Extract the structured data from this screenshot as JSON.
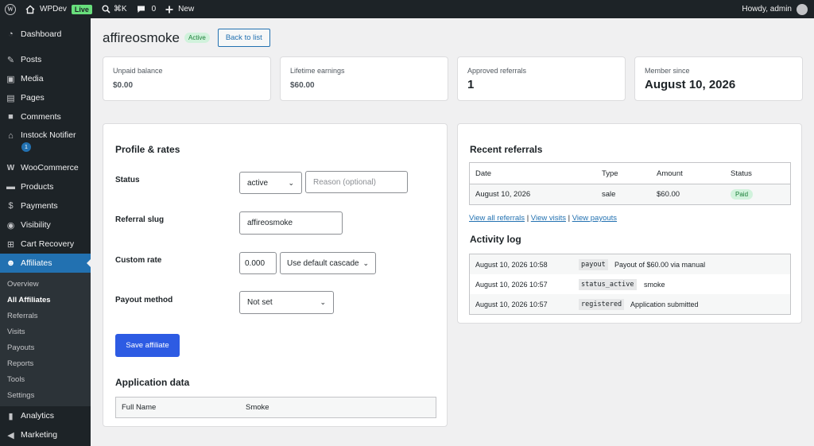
{
  "adminbar": {
    "site_name": "WPDev",
    "live_label": "Live",
    "search_shortcut": "⌘K",
    "comments_count": "0",
    "new_label": "New",
    "greeting": "Howdy, admin"
  },
  "sidebar": {
    "items": [
      {
        "label": "Dashboard",
        "icon": "dashboard-icon"
      },
      {
        "label": "Posts",
        "icon": "pin-icon"
      },
      {
        "label": "Media",
        "icon": "media-icon"
      },
      {
        "label": "Pages",
        "icon": "pages-icon"
      },
      {
        "label": "Comments",
        "icon": "comment-icon"
      },
      {
        "label": "Instock Notifier",
        "icon": "store-icon",
        "badge": "1"
      },
      {
        "label": "WooCommerce",
        "icon": "woo-icon"
      },
      {
        "label": "Products",
        "icon": "archive-icon"
      },
      {
        "label": "Payments",
        "icon": "dollar-icon"
      },
      {
        "label": "Visibility",
        "icon": "eye-icon"
      },
      {
        "label": "Cart Recovery",
        "icon": "cart-icon"
      },
      {
        "label": "Affiliates",
        "icon": "groups-icon"
      }
    ],
    "submenu": [
      "Overview",
      "All Affiliates",
      "Referrals",
      "Visits",
      "Payouts",
      "Reports",
      "Tools",
      "Settings"
    ],
    "after": [
      {
        "label": "Analytics",
        "icon": "bar-chart-icon"
      },
      {
        "label": "Marketing",
        "icon": "megaphone-icon"
      }
    ]
  },
  "page": {
    "title": "affireosmoke",
    "status": "Active",
    "back_label": "Back to list"
  },
  "stats": [
    {
      "label": "Unpaid balance",
      "value": "$0.00"
    },
    {
      "label": "Lifetime earnings",
      "value": "$60.00"
    },
    {
      "label": "Approved referrals",
      "value": "1"
    },
    {
      "label": "Member since",
      "value": "August 10, 2026"
    }
  ],
  "profile": {
    "heading": "Profile & rates",
    "status_label": "Status",
    "status_value": "active",
    "reason_placeholder": "Reason (optional)",
    "slug_label": "Referral slug",
    "slug_value": "affireosmoke",
    "rate_label": "Custom rate",
    "rate_value": "0.000",
    "rate_cascade": "Use default cascade",
    "payout_label": "Payout method",
    "payout_value": "Not set",
    "save_label": "Save affiliate",
    "app_heading": "Application data",
    "app_field": "Full Name",
    "app_value": "Smoke"
  },
  "referrals": {
    "heading": "Recent referrals",
    "columns": [
      "Date",
      "Type",
      "Amount",
      "Status"
    ],
    "rows": [
      {
        "date": "August 10, 2026",
        "type": "sale",
        "amount": "$60.00",
        "status": "Paid"
      }
    ],
    "link_referrals": "View all referrals",
    "link_visits": "View visits",
    "link_payouts": "View payouts",
    "separator": "|"
  },
  "activity": {
    "heading": "Activity log",
    "rows": [
      {
        "time": "August 10, 2026 10:58",
        "code": "payout",
        "message": "Payout of $60.00 via manual"
      },
      {
        "time": "August 10, 2026 10:57",
        "code": "status_active",
        "message": "smoke"
      },
      {
        "time": "August 10, 2026 10:57",
        "code": "registered",
        "message": "Application submitted"
      }
    ]
  },
  "colors": {
    "admin_dark": "#1d2327",
    "accent": "#2271b1",
    "save_button": "#2d5be3",
    "success": "#1a7f37"
  }
}
